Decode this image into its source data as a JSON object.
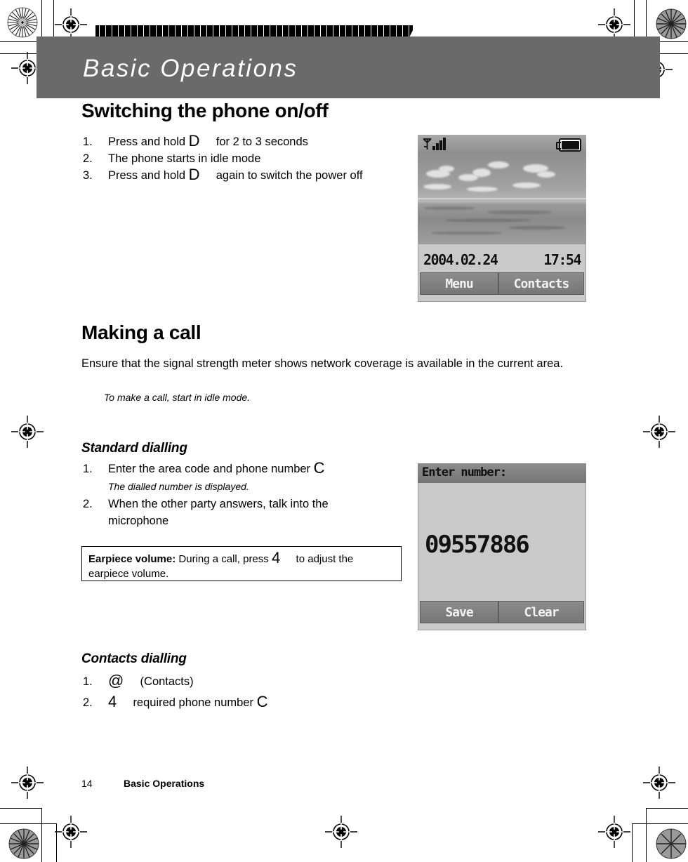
{
  "page": {
    "header_title": "Basic Operations",
    "footer_page_number": "14",
    "footer_section": "Basic Operations"
  },
  "sections": [
    {
      "id": "switching",
      "heading": "Switching the phone on/off",
      "steps": [
        {
          "num": "1.",
          "pre": "Press and hold",
          "key": "D",
          "post": "for 2 to 3 seconds"
        },
        {
          "num": "2.",
          "pre": "The phone starts in idle mode",
          "key": "",
          "post": ""
        },
        {
          "num": "3.",
          "pre": "Press and hold",
          "key": "D",
          "post": "again to switch the power off"
        }
      ]
    },
    {
      "id": "making-a-call",
      "heading": "Making a call",
      "body": "Ensure that the signal strength meter shows network coverage is available in the current area.",
      "note_italic": "To make a call, start in idle mode."
    },
    {
      "id": "standard-dialling",
      "heading": "Standard dialling",
      "steps": [
        {
          "num": "1.",
          "pre": "Enter the area code and phone number",
          "key": "C",
          "post": "",
          "sub": "The dialled number is displayed."
        },
        {
          "num": "2.",
          "pre": "When the other party answers, talk into the microphone",
          "key": "",
          "post": "",
          "sub": ""
        }
      ]
    },
    {
      "id": "contacts-dialling",
      "heading": "Contacts dialling",
      "steps": [
        {
          "num": "1.",
          "pre": "",
          "key": "@",
          "post": "(Contacts)"
        },
        {
          "num": "2.",
          "pre": "",
          "key": "4",
          "post": "required phone number",
          "key2": "C"
        }
      ]
    }
  ],
  "notebox": {
    "label": "Earpiece volume:",
    "text_before_key": "During a call, press",
    "key": "4",
    "text_after_key": "to adjust the earpiece volume."
  },
  "phone_idle": {
    "status_signal_icon": "signal-bars-icon",
    "status_battery_icon": "battery-full-icon",
    "date": "2004.02.24",
    "time": "17:54",
    "softkey_left": "Menu",
    "softkey_right": "Contacts"
  },
  "phone_dial": {
    "title": "Enter number:",
    "number": "09557886",
    "softkey_left": "Save",
    "softkey_right": "Clear"
  },
  "colors": {
    "header_band": "#6a6a6a",
    "phone_screen_bg": "#c9c9c9",
    "softkey_bg": "#7f7f7f",
    "text": "#000000"
  }
}
